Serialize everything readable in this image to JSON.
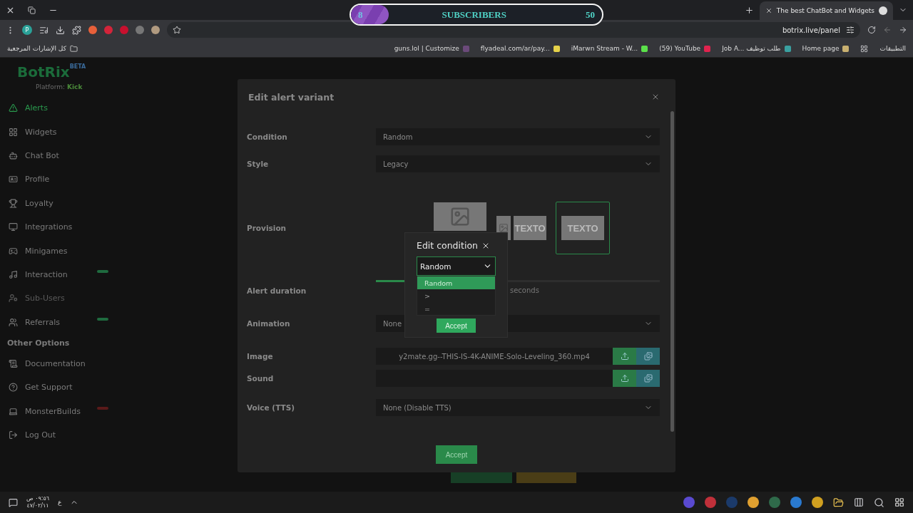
{
  "browser": {
    "tab": {
      "title": "The best ChatBot and Widgets"
    },
    "url": "botrix.live/panel",
    "profile_initial": "P",
    "all_bookmarks": "كل الإشارات المرجعية",
    "bookmarks": [
      {
        "label": "guns.lol | Customize"
      },
      {
        "label": "flyadeal.com/ar/pay..."
      },
      {
        "label": "iMarwn Stream - W..."
      },
      {
        "label": "(59) YouTube"
      },
      {
        "label": "Job A... طلب توظيف"
      },
      {
        "label": "Home page"
      }
    ],
    "apps_label": "التطبيقات"
  },
  "subscriber_goal": {
    "current": "8",
    "label": "SUBSCRIBERS",
    "target": "50",
    "level": 0.15
  },
  "sidebar": {
    "logo": "BotRix",
    "logo_badge": "BETA",
    "platform_label": "Platform:",
    "platform": "Kick",
    "items": [
      {
        "label": "Alerts",
        "selected": true,
        "disabled": false
      },
      {
        "label": "Widgets",
        "selected": false,
        "disabled": false
      },
      {
        "label": "Chat Bot",
        "selected": false,
        "disabled": false
      },
      {
        "label": "Profile",
        "selected": false,
        "disabled": false
      },
      {
        "label": "Loyalty",
        "selected": false,
        "disabled": false
      },
      {
        "label": "Integrations",
        "selected": false,
        "disabled": false
      },
      {
        "label": "Minigames",
        "selected": false,
        "disabled": false
      },
      {
        "label": "Interaction",
        "selected": false,
        "disabled": false,
        "color": "#1f6b3f"
      },
      {
        "label": "Sub-Users",
        "selected": false,
        "disabled": true
      },
      {
        "label": "Referrals",
        "selected": false,
        "disabled": false,
        "color": "#1f6b3f"
      }
    ],
    "section_title": "Other Options",
    "other_items": [
      {
        "label": "Documentation"
      },
      {
        "label": "Get Support"
      },
      {
        "label": "MonsterBuilds",
        "color": "#5a1a1a"
      },
      {
        "label": "Log Out"
      }
    ]
  },
  "modal": {
    "title": "Edit alert variant",
    "fields": [
      {
        "kind": "select",
        "label": "Condition",
        "value": "Random"
      },
      {
        "kind": "select",
        "label": "Style",
        "value": "Legacy"
      },
      {
        "kind": "provision",
        "label": "Provision",
        "options": [
          {
            "selected": false
          },
          {
            "text": "TEXTO",
            "selected": false
          },
          {
            "text": "TEXTO",
            "selected": true
          }
        ]
      },
      {
        "kind": "slider",
        "label": "Alert duration",
        "level": 0.2,
        "unit": "seconds"
      },
      {
        "kind": "select",
        "label": "Animation",
        "value": "None"
      },
      {
        "kind": "file",
        "label": "Image",
        "value": "y2mate.gg--THIS-IS-4K-ANIME-Solo-Leveling_360.mp4"
      },
      {
        "kind": "file",
        "label": "Sound"
      },
      {
        "kind": "select",
        "label": "Voice (TTS)",
        "value": "None (Disable TTS)"
      }
    ],
    "accept": "Accept"
  },
  "condition_popup": {
    "title": "Edit condition",
    "value": "Random",
    "options": [
      {
        "label": "Random",
        "selected": true
      },
      {
        "label": ">",
        "selected": false
      },
      {
        "label": "=",
        "selected": false
      }
    ],
    "accept": "Accept"
  },
  "taskbar": {
    "time": "٠٩:٥٦ ص",
    "date": "٤٧/٠٢/١١",
    "language": "ع"
  }
}
